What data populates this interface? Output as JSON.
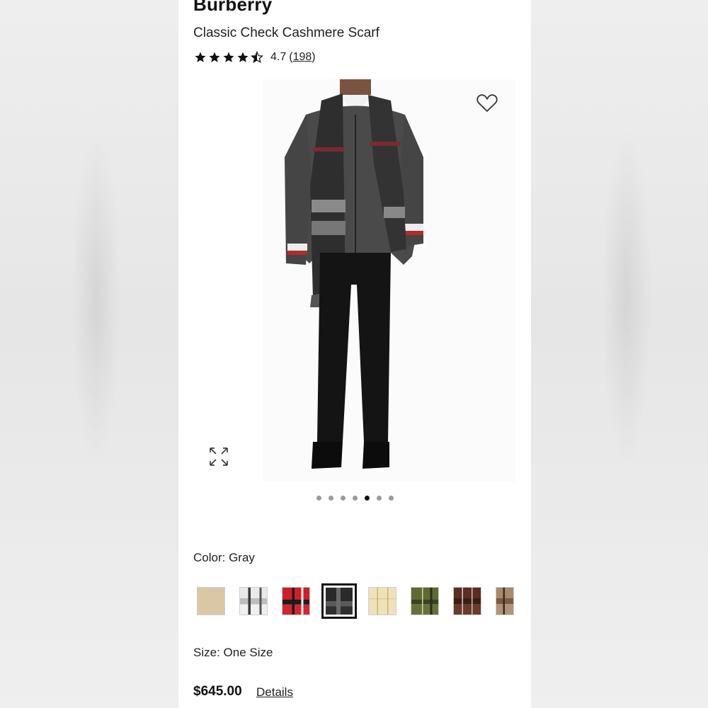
{
  "product": {
    "brand": "Burberry",
    "name": "Classic Check Cashmere Scarf",
    "rating_value": "4.7",
    "rating_count_open": "(",
    "rating_count": "198",
    "rating_count_close": ")",
    "rating_stars": 4.5
  },
  "gallery": {
    "image_count": 7,
    "active_index": 4,
    "icons": [
      "heart-icon",
      "expand-icon"
    ]
  },
  "color": {
    "label": "Color: Gray",
    "swatches": [
      {
        "name": "camel",
        "selected": false
      },
      {
        "name": "white-check",
        "selected": false
      },
      {
        "name": "red-check",
        "selected": false
      },
      {
        "name": "gray-check",
        "selected": true
      },
      {
        "name": "archive-beige-check",
        "selected": false
      },
      {
        "name": "olive-check",
        "selected": false
      },
      {
        "name": "brown-check",
        "selected": false
      },
      {
        "name": "birch-brown-check",
        "selected": false
      }
    ]
  },
  "size": {
    "label": "Size: One Size"
  },
  "pricing": {
    "price": "$645.00",
    "details_label": "Details"
  },
  "colors": {
    "star": "#111111",
    "text": "#222222",
    "active_dot": "#111111",
    "inactive_dot": "#9a9a9a"
  }
}
